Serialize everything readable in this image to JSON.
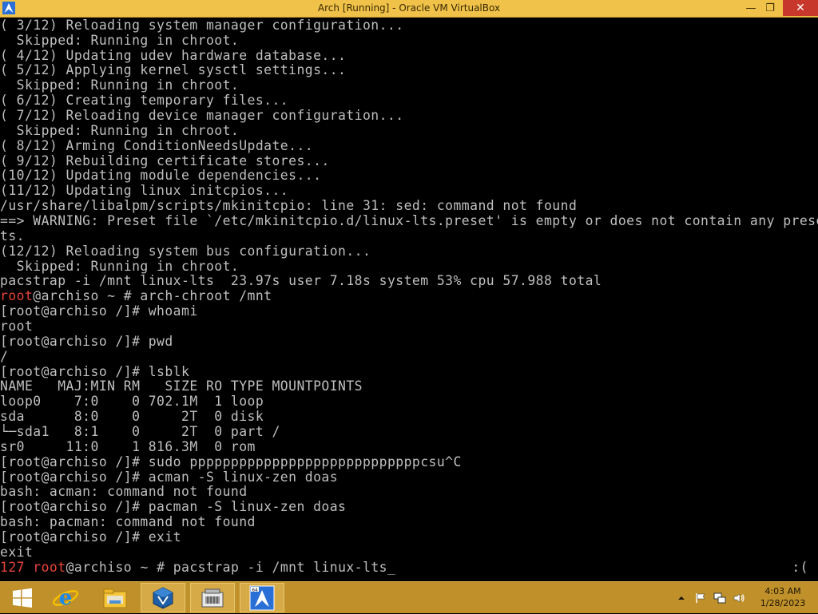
{
  "window": {
    "title": "Arch [Running] - Oracle VM VirtualBox",
    "minimize_glyph": "—",
    "maximize_glyph": "❐",
    "close_glyph": "✕"
  },
  "terminal": {
    "lines": [
      "( 3/12) Reloading system manager configuration...",
      "  Skipped: Running in chroot.",
      "( 4/12) Updating udev hardware database...",
      "( 5/12) Applying kernel sysctl settings...",
      "  Skipped: Running in chroot.",
      "( 6/12) Creating temporary files...",
      "( 7/12) Reloading device manager configuration...",
      "  Skipped: Running in chroot.",
      "( 8/12) Arming ConditionNeedsUpdate...",
      "( 9/12) Rebuilding certificate stores...",
      "(10/12) Updating module dependencies...",
      "(11/12) Updating linux initcpios...",
      "/usr/share/libalpm/scripts/mkinitcpio: line 31: sed: command not found",
      "==> WARNING: Preset file `/etc/mkinitcpio.d/linux-lts.preset' is empty or does not contain any prese",
      "ts.",
      "(12/12) Reloading system bus configuration...",
      "  Skipped: Running in chroot.",
      "pacstrap -i /mnt linux-lts  23.97s user 7.18s system 53% cpu 57.988 total"
    ],
    "prompt1": {
      "user": "root",
      "rest": "@archiso ~ # arch-chroot /mnt"
    },
    "lines2": [
      "[root@archiso /]# whoami",
      "root",
      "[root@archiso /]# pwd",
      "/",
      "[root@archiso /]# lsblk",
      "NAME   MAJ:MIN RM   SIZE RO TYPE MOUNTPOINTS",
      "loop0    7:0    0 702.1M  1 loop",
      "sda      8:0    0     2T  0 disk",
      "└─sda1   8:1    0     2T  0 part /",
      "sr0     11:0    1 816.3M  0 rom",
      "[root@archiso /]# sudo ppppppppppppppppppppppppppppcsu^C",
      "[root@archiso /]# acman -S linux-zen doas",
      "bash: acman: command not found",
      "[root@archiso /]# pacman -S linux-zen doas",
      "bash: pacman: command not found",
      "[root@archiso /]# exit",
      "exit"
    ],
    "last": {
      "code": "127",
      "user": "root",
      "rest": "@archiso ~ # pacstrap -i /mnt linux-lts",
      "cursor": "_",
      "face": ":("
    }
  },
  "taskbar": {
    "items": [
      "start-button",
      "internet-explorer",
      "file-explorer",
      "virtualbox-manager",
      "shell-app",
      "arch-vm"
    ],
    "clock_time": "4:03 AM",
    "clock_date": "1/28/2023",
    "colors": {
      "bar": "#c0912a",
      "titlebar": "#f0c24a",
      "close": "#c7372b"
    }
  }
}
